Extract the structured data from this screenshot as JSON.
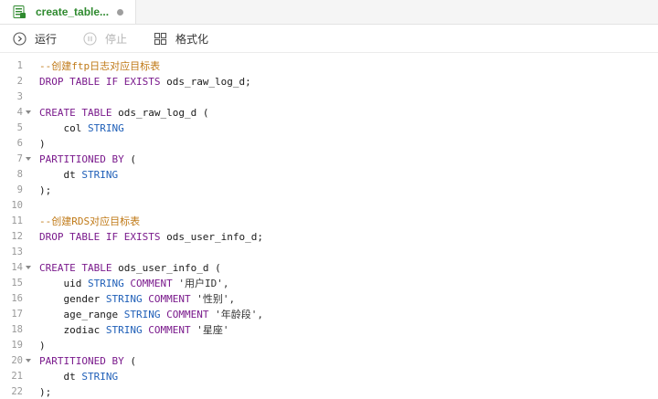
{
  "tab": {
    "title": "create_table..."
  },
  "toolbar": {
    "run": "运行",
    "stop": "停止",
    "format": "格式化"
  },
  "lines": [
    {
      "n": "1",
      "fold": false,
      "segs": [
        {
          "c": "cm",
          "t": "--创建ftp日志对应目标表"
        }
      ]
    },
    {
      "n": "2",
      "fold": false,
      "segs": [
        {
          "c": "kw",
          "t": "DROP TABLE IF EXISTS"
        },
        {
          "c": "",
          "t": " ods_raw_log_d;"
        }
      ]
    },
    {
      "n": "3",
      "fold": false,
      "segs": []
    },
    {
      "n": "4",
      "fold": true,
      "segs": [
        {
          "c": "kw",
          "t": "CREATE TABLE"
        },
        {
          "c": "",
          "t": " ods_raw_log_d ("
        }
      ]
    },
    {
      "n": "5",
      "fold": false,
      "segs": [
        {
          "c": "",
          "t": "    col "
        },
        {
          "c": "ty",
          "t": "STRING"
        }
      ]
    },
    {
      "n": "6",
      "fold": false,
      "segs": [
        {
          "c": "",
          "t": ")"
        }
      ]
    },
    {
      "n": "7",
      "fold": true,
      "segs": [
        {
          "c": "kw",
          "t": "PARTITIONED BY"
        },
        {
          "c": "",
          "t": " ("
        }
      ]
    },
    {
      "n": "8",
      "fold": false,
      "segs": [
        {
          "c": "",
          "t": "    dt "
        },
        {
          "c": "ty",
          "t": "STRING"
        }
      ]
    },
    {
      "n": "9",
      "fold": false,
      "segs": [
        {
          "c": "",
          "t": ");"
        }
      ]
    },
    {
      "n": "10",
      "fold": false,
      "segs": []
    },
    {
      "n": "11",
      "fold": false,
      "segs": [
        {
          "c": "cm",
          "t": "--创建RDS对应目标表"
        }
      ]
    },
    {
      "n": "12",
      "fold": false,
      "segs": [
        {
          "c": "kw",
          "t": "DROP TABLE IF EXISTS"
        },
        {
          "c": "",
          "t": " ods_user_info_d;"
        }
      ]
    },
    {
      "n": "13",
      "fold": false,
      "segs": []
    },
    {
      "n": "14",
      "fold": true,
      "segs": [
        {
          "c": "kw",
          "t": "CREATE TABLE"
        },
        {
          "c": "",
          "t": " ods_user_info_d ("
        }
      ]
    },
    {
      "n": "15",
      "fold": false,
      "segs": [
        {
          "c": "",
          "t": "    uid "
        },
        {
          "c": "ty",
          "t": "STRING"
        },
        {
          "c": "",
          "t": " "
        },
        {
          "c": "kw",
          "t": "COMMENT"
        },
        {
          "c": "st",
          "t": " '用户ID',"
        }
      ]
    },
    {
      "n": "16",
      "fold": false,
      "segs": [
        {
          "c": "",
          "t": "    gender "
        },
        {
          "c": "ty",
          "t": "STRING"
        },
        {
          "c": "",
          "t": " "
        },
        {
          "c": "kw",
          "t": "COMMENT"
        },
        {
          "c": "st",
          "t": " '性别',"
        }
      ]
    },
    {
      "n": "17",
      "fold": false,
      "segs": [
        {
          "c": "",
          "t": "    age_range "
        },
        {
          "c": "ty",
          "t": "STRING"
        },
        {
          "c": "",
          "t": " "
        },
        {
          "c": "kw",
          "t": "COMMENT"
        },
        {
          "c": "st",
          "t": " '年龄段',"
        }
      ]
    },
    {
      "n": "18",
      "fold": false,
      "segs": [
        {
          "c": "",
          "t": "    zodiac "
        },
        {
          "c": "ty",
          "t": "STRING"
        },
        {
          "c": "",
          "t": " "
        },
        {
          "c": "kw",
          "t": "COMMENT"
        },
        {
          "c": "st",
          "t": " '星座'"
        }
      ]
    },
    {
      "n": "19",
      "fold": false,
      "segs": [
        {
          "c": "",
          "t": ")"
        }
      ]
    },
    {
      "n": "20",
      "fold": true,
      "segs": [
        {
          "c": "kw",
          "t": "PARTITIONED BY"
        },
        {
          "c": "",
          "t": " ("
        }
      ]
    },
    {
      "n": "21",
      "fold": false,
      "segs": [
        {
          "c": "",
          "t": "    dt "
        },
        {
          "c": "ty",
          "t": "STRING"
        }
      ]
    },
    {
      "n": "22",
      "fold": false,
      "segs": [
        {
          "c": "",
          "t": ");"
        }
      ]
    }
  ]
}
